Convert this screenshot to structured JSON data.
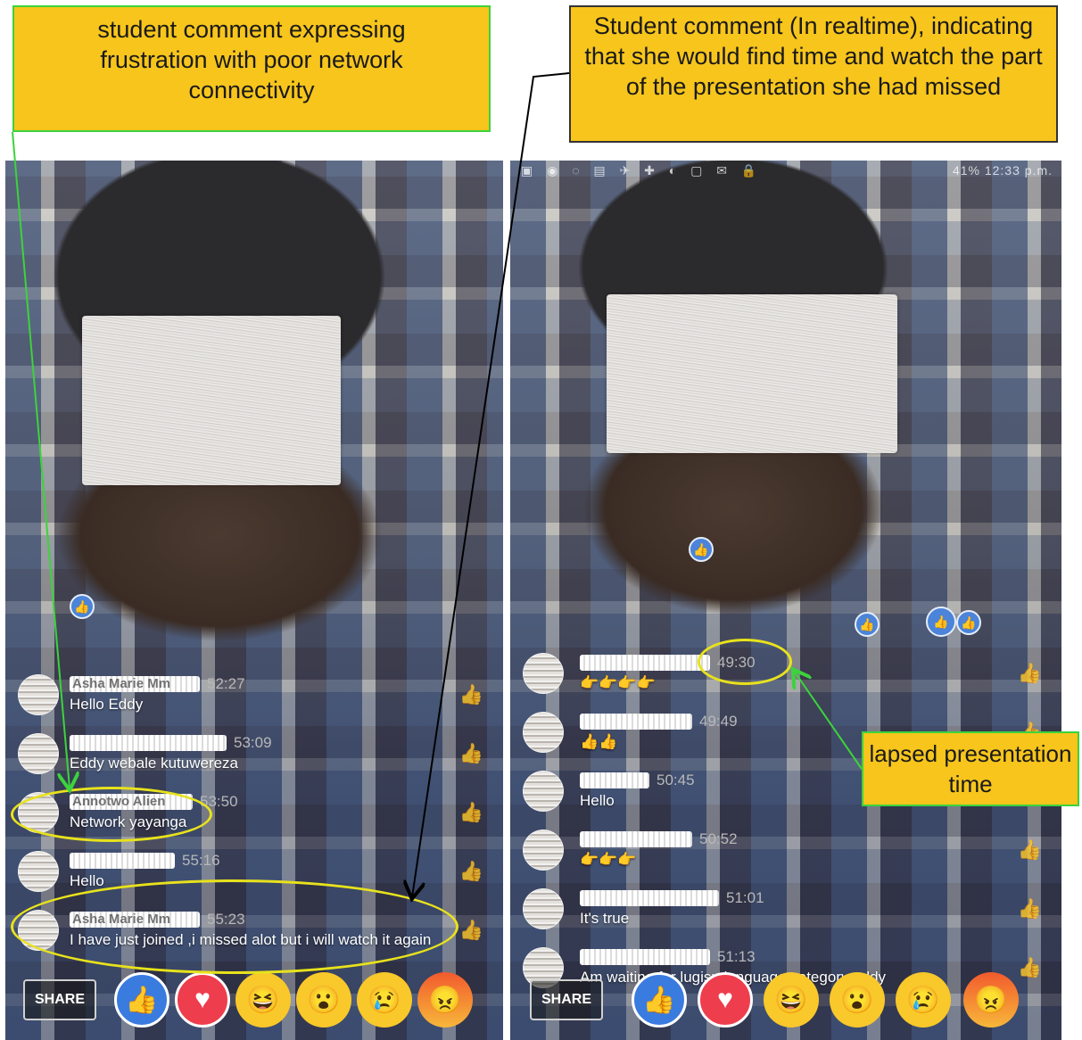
{
  "callouts": {
    "frustration": "student comment expressing frustration with poor network connectivity",
    "realtime": "Student comment (In realtime), indicating that she would find time and watch the part of the presentation she had missed",
    "lapsed": "lapsed presentation time"
  },
  "status_bar": {
    "right_text": "41% 12:33 p.m.",
    "icons": [
      "notification-icons",
      "mute-icon",
      "alarm-icon",
      "signal-icon",
      "battery-icon"
    ]
  },
  "left_panel": {
    "comments": [
      {
        "name": "Asha Marie Mm",
        "time": "52:27",
        "text": "Hello Eddy"
      },
      {
        "name": "",
        "time": "53:09",
        "text": "Eddy webale kutuwereza"
      },
      {
        "name": "Annotwo Alien",
        "time": "53:50",
        "text": "Network  yayanga"
      },
      {
        "name": "",
        "time": "55:16",
        "text": "Hello"
      },
      {
        "name": "Asha Marie Mm",
        "time": "55:23",
        "text": "I have just joined ,i missed alot but i will watch it again"
      }
    ],
    "share_label": "SHARE"
  },
  "right_panel": {
    "comments": [
      {
        "name": "",
        "time": "49:30",
        "text": "👉👉👉👉"
      },
      {
        "name": "",
        "time": "49:49",
        "text": "👍👍"
      },
      {
        "name": "",
        "time": "50:45",
        "text": "Hello"
      },
      {
        "name": "",
        "time": "50:52",
        "text": "👉👉👉"
      },
      {
        "name": "",
        "time": "51:01",
        "text": "It's true"
      },
      {
        "name": "",
        "time": "51:13",
        "text": "Am waiting for lugisu language category eddy"
      }
    ],
    "share_label": "SHARE"
  },
  "reactions": [
    "like",
    "love",
    "haha",
    "wow",
    "sad",
    "angry"
  ],
  "colors": {
    "callout_fill": "#f7c51c",
    "ellipse": "#e8e21c",
    "green_arrow": "#3cd33c",
    "fb_blue": "#3a7be0"
  }
}
